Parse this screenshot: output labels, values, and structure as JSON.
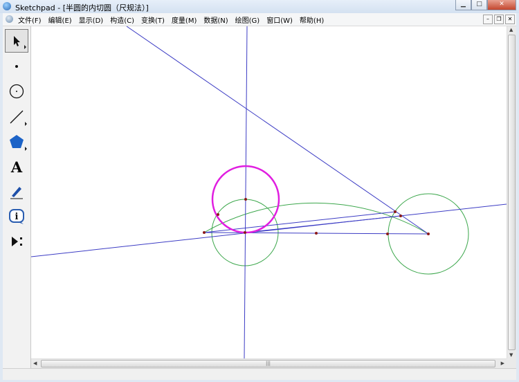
{
  "window": {
    "title": "Sketchpad - [半圆的内切圆（尺规法）]",
    "controls": [
      "minimize-icon",
      "maximize-icon",
      "close-icon"
    ]
  },
  "menu": {
    "items": [
      "文件(F)",
      "编辑(E)",
      "显示(D)",
      "构造(C)",
      "变换(T)",
      "度量(M)",
      "数据(N)",
      "绘图(G)",
      "窗口(W)",
      "帮助(H)"
    ]
  },
  "toolbox": {
    "tools": [
      "arrow-select-icon",
      "point-icon",
      "compass-icon",
      "straightedge-icon",
      "polygon-icon",
      "text-icon",
      "marker-icon",
      "information-icon",
      "custom-tool-icon"
    ],
    "active": "arrow-select-icon",
    "text_tool_glyph": "A"
  },
  "scrollbar": {
    "grip": "|||"
  },
  "colors": {
    "line": "#3b3bc4",
    "arc": "#3aa64a",
    "incircle": "#e01ee0",
    "point": "#8b1a1a"
  }
}
